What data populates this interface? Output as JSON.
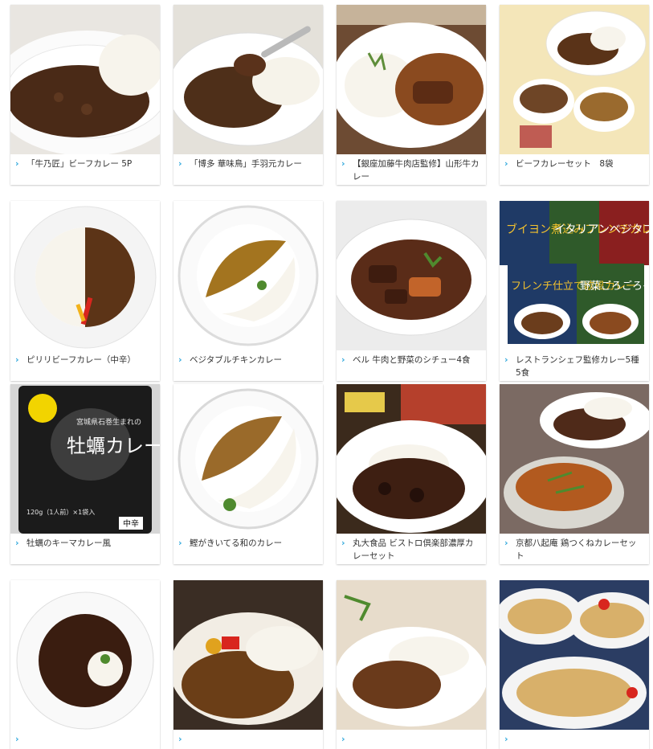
{
  "products": [
    {
      "name": "「牛乃匠」ビーフカレー 5P",
      "icon": "chevron-right-icon"
    },
    {
      "name": "「博多 華味鳥」手羽元カレー",
      "icon": "chevron-right-icon"
    },
    {
      "name": "【銀座加藤牛肉店監修】山形牛カレー",
      "icon": "chevron-right-icon"
    },
    {
      "name": "ビーフカレーセット　8袋",
      "icon": "chevron-right-icon"
    },
    {
      "name": "ピリリビーフカレー（中辛）",
      "icon": "chevron-right-icon"
    },
    {
      "name": "ベジタブルチキンカレー",
      "icon": "chevron-right-icon"
    },
    {
      "name": "ベル 牛肉と野菜のシチュー4食",
      "icon": "chevron-right-icon"
    },
    {
      "name": "レストランシェフ監修カレー5種5食",
      "icon": "chevron-right-icon"
    },
    {
      "name": "牡蠣のキーマカレー風",
      "icon": "chevron-right-icon"
    },
    {
      "name": "鰹がきいてる和のカレー",
      "icon": "chevron-right-icon"
    },
    {
      "name": "丸大食品 ビストロ倶楽部濃厚カレーセット",
      "icon": "chevron-right-icon"
    },
    {
      "name": "京都八起庵 鶏つくねカレーセット",
      "icon": "chevron-right-icon"
    },
    {
      "name": "",
      "icon": "chevron-right-icon"
    },
    {
      "name": "",
      "icon": "chevron-right-icon"
    },
    {
      "name": "",
      "icon": "chevron-right-icon"
    },
    {
      "name": "",
      "icon": "chevron-right-icon"
    }
  ],
  "package_texts": {
    "oyster_title": "牡蠣カレー",
    "oyster_sub": "宮城県石巻生まれの",
    "oyster_weight": "120g（1人前）×1袋入",
    "oyster_spice": "中辛",
    "chef_box_1": "ブイヨン煮込みフレンチカレー",
    "chef_box_2": "イタリアンベジタブルカレー",
    "chef_box_3": "フレンチ仕立て欧風カレー",
    "chef_box_4": "野菜ごろごろイタリアンカレー"
  },
  "colors": {
    "accent": "#31a9dd",
    "caption_text": "#333333",
    "curry_brown": "#4a2a17",
    "rice_white": "#f7f4ec"
  }
}
